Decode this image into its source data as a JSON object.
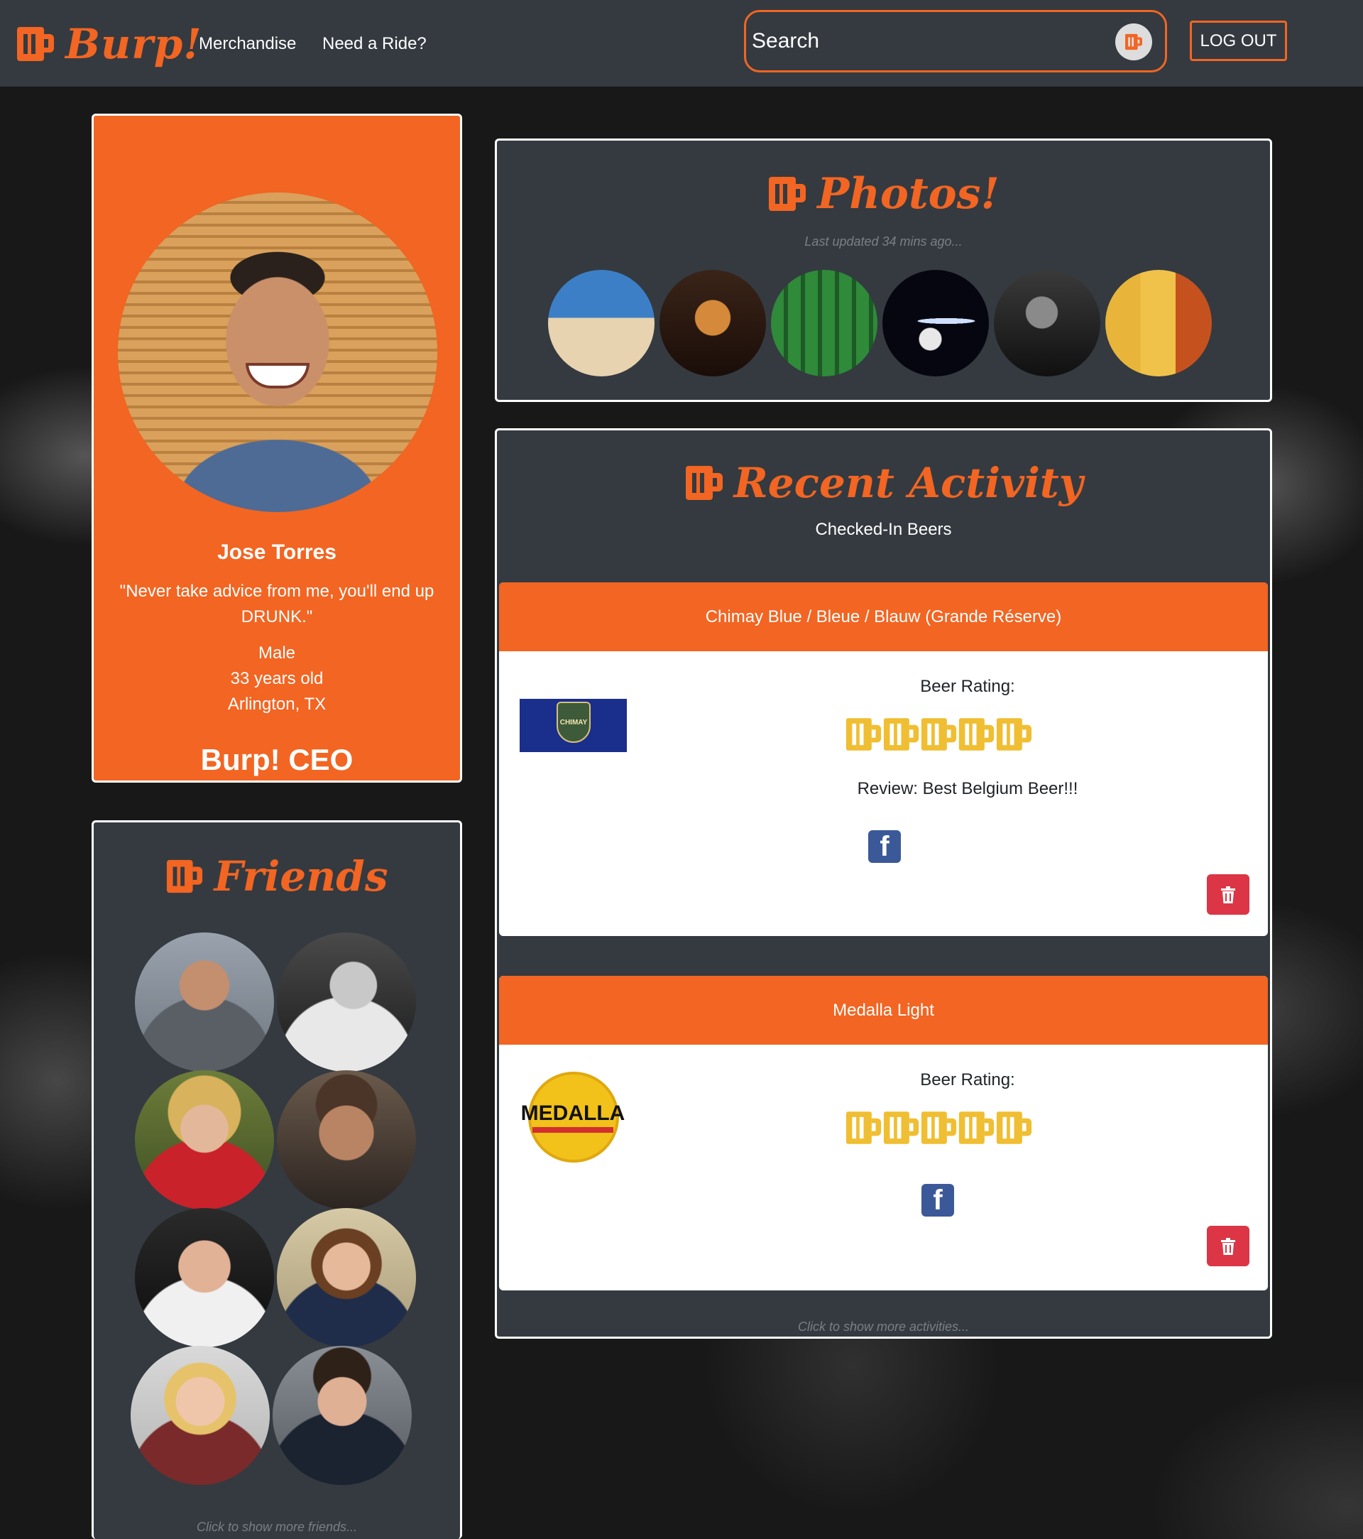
{
  "nav": {
    "brand": "Burp!",
    "links": [
      "Merchandise",
      "Need a Ride?"
    ],
    "search_placeholder": "Search",
    "logout": "LOG OUT"
  },
  "profile": {
    "name": "Jose Torres",
    "quote": "\"Never take advice from me, you'll end up DRUNK.\"",
    "gender": "Male",
    "age": "33 years old",
    "location": "Arlington, TX",
    "title": "Burp! CEO"
  },
  "friends": {
    "title": "Friends",
    "more": "Click to show more friends..."
  },
  "photos": {
    "title": "Photos!",
    "updated": "Last updated 34 mins ago..."
  },
  "activity": {
    "title": "Recent Activity",
    "subtitle": "Checked-In Beers",
    "more": "Click to show more activities...",
    "items": [
      {
        "beer": "Chimay Blue / Bleue / Blauw (Grande Réserve)",
        "rating_label": "Beer Rating:",
        "rating": 5,
        "review": "Review: Best Belgium Beer!!!"
      },
      {
        "beer": "Medalla Light",
        "rating_label": "Beer Rating:",
        "rating": 5,
        "review": ""
      }
    ]
  },
  "colors": {
    "accent": "#f26522",
    "panel": "#343a40",
    "mug": "#f0be32",
    "facebook": "#3b5998",
    "delete": "#dc3545"
  }
}
